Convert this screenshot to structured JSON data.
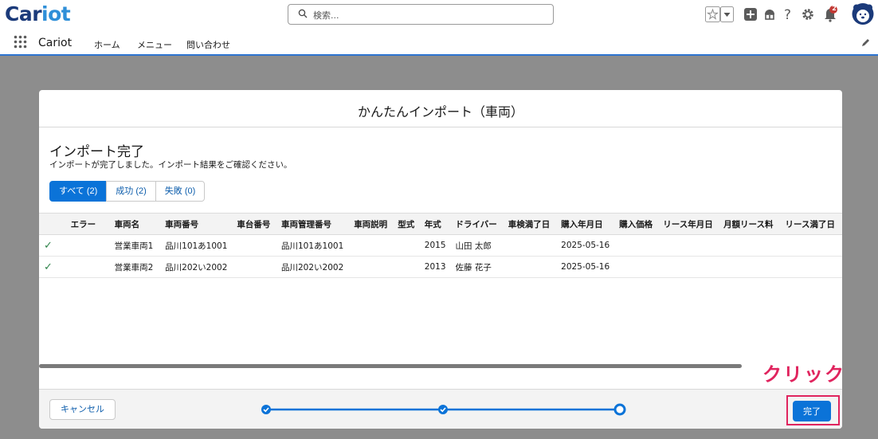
{
  "header": {
    "logo_text": "Car",
    "logo_text2": "iot",
    "search_placeholder": "検索...",
    "notification_count": "2"
  },
  "nav": {
    "app_name": "Cariot",
    "items": [
      "ホーム",
      "メニュー",
      "問い合わせ"
    ]
  },
  "modal": {
    "title": "かんたんインポート（車両）",
    "section_title": "インポート完了",
    "section_subtitle": "インポートが完了しました。インポート結果をご確認ください。",
    "filters": [
      {
        "label": "すべて (2)",
        "active": true
      },
      {
        "label": "成功 (2)",
        "active": false
      },
      {
        "label": "失敗 (0)",
        "active": false
      }
    ],
    "table": {
      "columns": [
        "",
        "エラー",
        "車両名",
        "車両番号",
        "車台番号",
        "車両管理番号",
        "車両説明",
        "型式",
        "年式",
        "ドライバー",
        "車検満了日",
        "購入年月日",
        "購入価格",
        "リース年月日",
        "月額リース料",
        "リース満了日"
      ],
      "rows": [
        [
          "✓",
          "",
          "営業車両1",
          "品川101あ1001",
          "",
          "品川101あ1001",
          "",
          "",
          "2015",
          "山田 太郎",
          "",
          "2025-05-16",
          "",
          "",
          "",
          ""
        ],
        [
          "✓",
          "",
          "営業車両2",
          "品川202い2002",
          "",
          "品川202い2002",
          "",
          "",
          "2013",
          "佐藤 花子",
          "",
          "2025-05-16",
          "",
          "",
          "",
          ""
        ]
      ]
    },
    "footer": {
      "cancel_label": "キャンセル",
      "done_label": "完了"
    }
  },
  "annotation": {
    "label": "クリック"
  },
  "colors": {
    "brand_blue": "#0b73d8",
    "success_green": "#2e844a",
    "annotation_pink": "#e0245e"
  }
}
